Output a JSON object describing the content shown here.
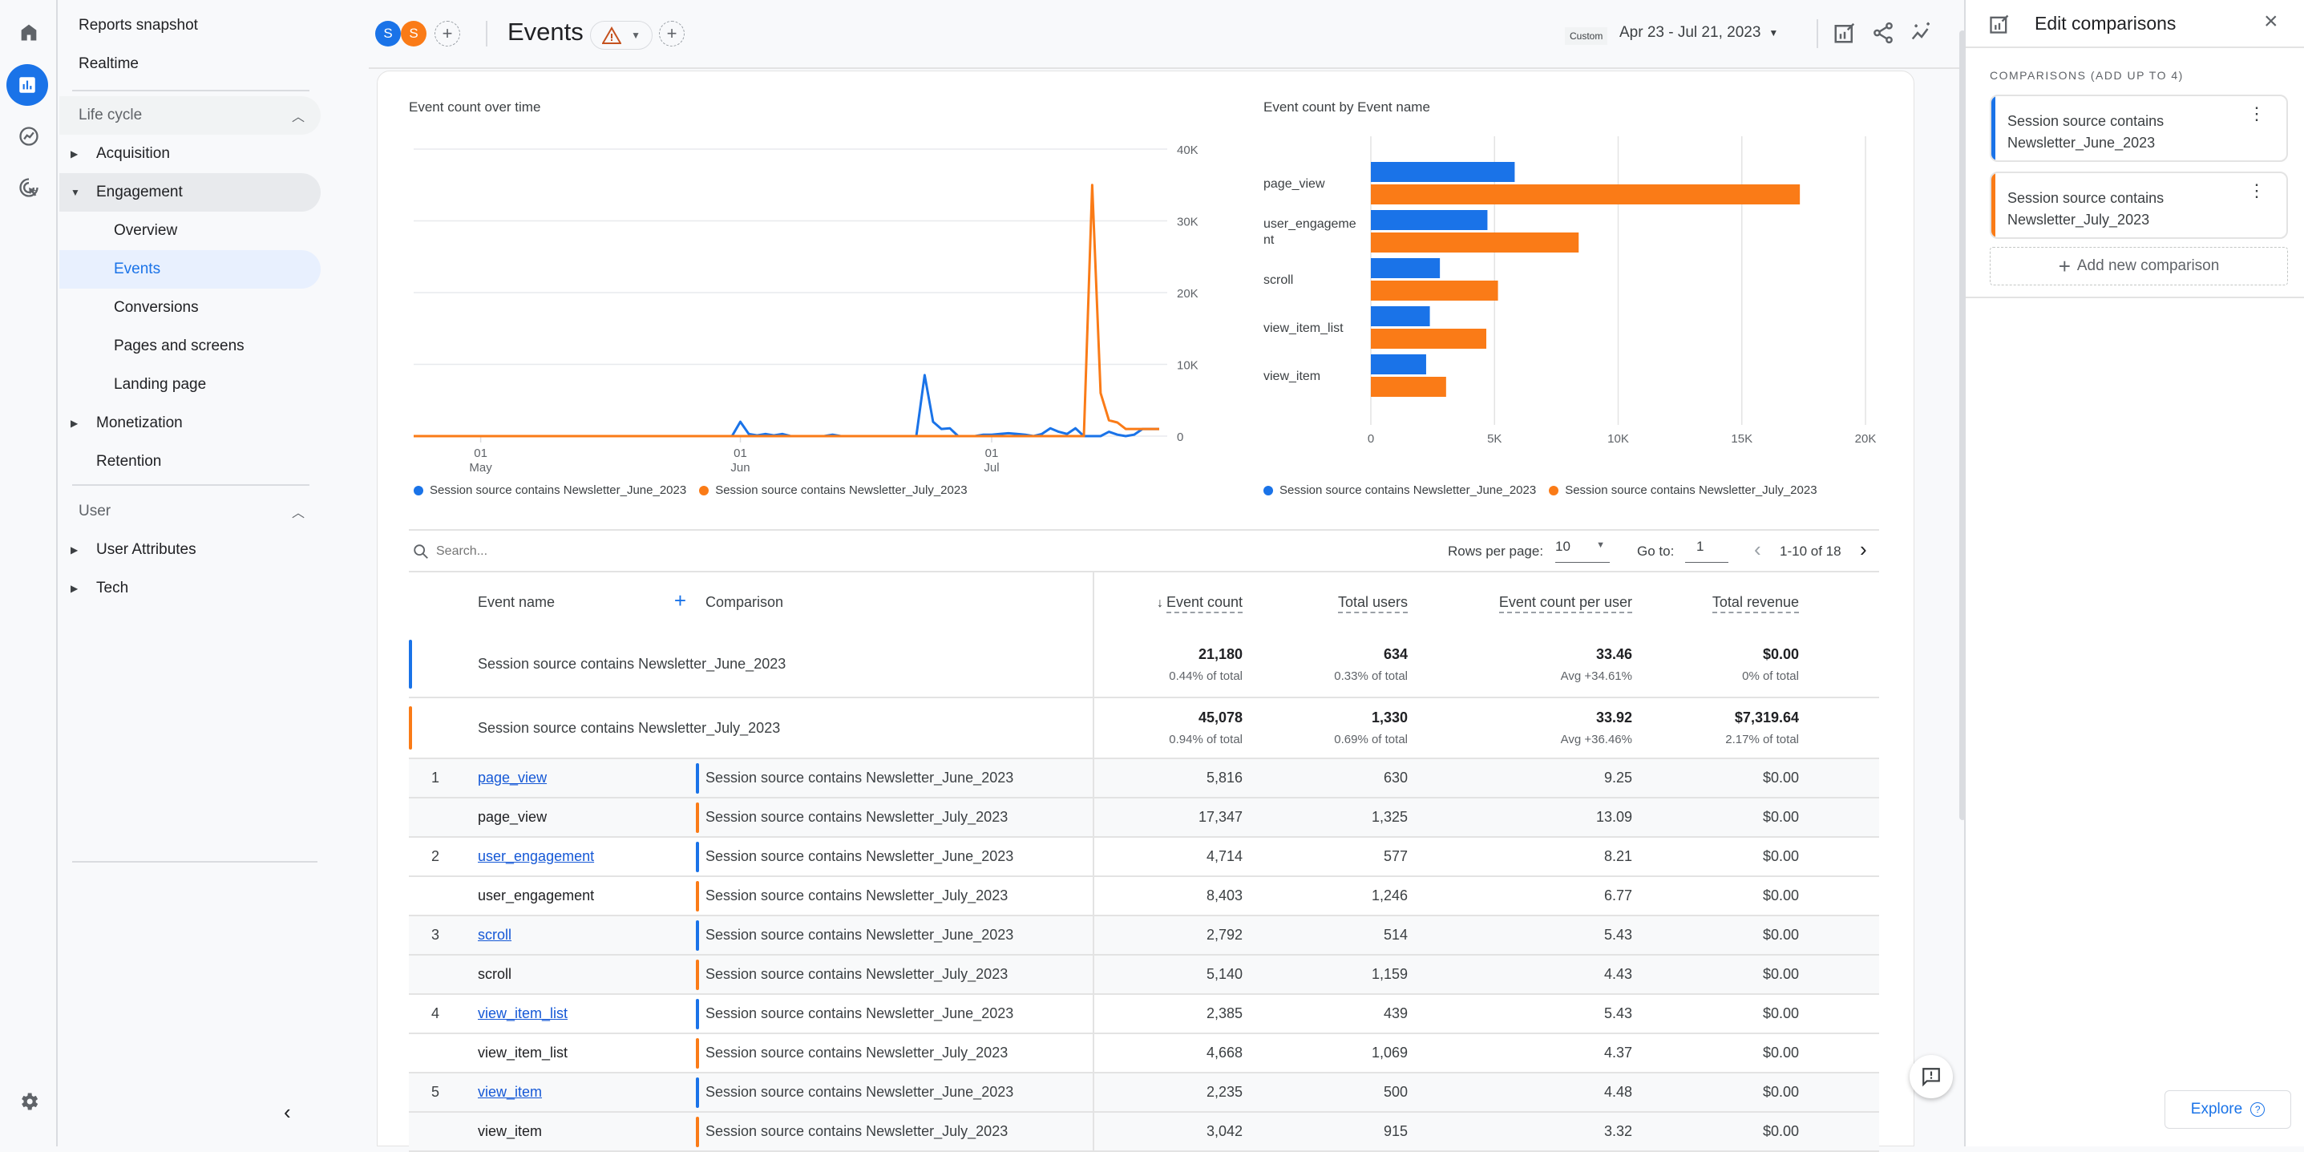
{
  "colors": {
    "blue": "#1a73e8",
    "orange": "#fa7b17",
    "accent": "#1a73e8",
    "warning": "#c5521f"
  },
  "rail": {
    "icons": [
      "home-icon",
      "reports-icon",
      "explore-icon",
      "advertising-icon",
      "settings-icon"
    ]
  },
  "sidebar": {
    "reports_snapshot": "Reports snapshot",
    "realtime": "Realtime",
    "lifecycle": "Life cycle",
    "acquisition": "Acquisition",
    "engagement": "Engagement",
    "overview": "Overview",
    "events": "Events",
    "conversions": "Conversions",
    "pages_and_screens": "Pages and screens",
    "landing_page": "Landing page",
    "monetization": "Monetization",
    "retention": "Retention",
    "user": "User",
    "user_attributes": "User Attributes",
    "tech": "Tech"
  },
  "header": {
    "avatars": [
      "S",
      "S"
    ],
    "title": "Events",
    "date_badge": "Custom",
    "date_range": "Apr 23 - Jul 21, 2023"
  },
  "line_chart": {
    "title": "Event count over time",
    "y_ticks": [
      "40K",
      "30K",
      "20K",
      "10K",
      "0"
    ],
    "x_ticks": [
      {
        "day": "01",
        "month": "May"
      },
      {
        "day": "01",
        "month": "Jun"
      },
      {
        "day": "01",
        "month": "Jul"
      }
    ],
    "legend": [
      "Session source contains Newsletter_June_2023",
      "Session source contains Newsletter_July_2023"
    ]
  },
  "chart_data": [
    {
      "type": "line",
      "title": "Event count over time",
      "xlabel": "",
      "ylabel": "",
      "x_range": [
        "2023-04-23",
        "2023-07-21"
      ],
      "ylim": [
        0,
        40000
      ],
      "y_ticks": [
        0,
        10000,
        20000,
        30000,
        40000
      ],
      "grid": true,
      "legend": "bottom",
      "series": [
        {
          "name": "Session source contains Newsletter_June_2023",
          "color": "#1a73e8",
          "x_days": [
            0,
            38,
            39,
            40,
            41,
            42,
            43,
            44,
            45,
            50,
            51,
            52,
            60,
            61,
            62,
            63,
            64,
            65,
            66,
            67,
            68,
            69,
            70,
            71,
            72,
            73,
            74,
            75,
            76,
            77,
            78,
            79,
            80,
            81,
            82,
            83,
            84,
            85,
            86,
            87,
            88,
            89
          ],
          "values": [
            0,
            0,
            2000,
            300,
            100,
            300,
            100,
            300,
            0,
            200,
            0,
            0,
            0,
            8500,
            2000,
            1000,
            1100,
            0,
            0,
            0,
            200,
            200,
            300,
            400,
            300,
            200,
            0,
            300,
            1100,
            600,
            300,
            1100,
            0,
            0,
            0,
            600,
            200,
            0,
            200,
            1000,
            1000,
            1000
          ]
        },
        {
          "name": "Session source contains Newsletter_July_2023",
          "color": "#fa7b17",
          "x_days": [
            0,
            80,
            81,
            82,
            83,
            84,
            85,
            86,
            87,
            88
          ],
          "values": [
            0,
            0,
            35000,
            6000,
            2200,
            1900,
            1000,
            1000,
            1000,
            1000
          ]
        }
      ]
    },
    {
      "type": "bar",
      "orientation": "horizontal",
      "title": "Event count by Event name",
      "categories": [
        "page_view",
        "user_engagement",
        "scroll",
        "view_item_list",
        "view_item"
      ],
      "series": [
        {
          "name": "Session source contains Newsletter_June_2023",
          "color": "#1a73e8",
          "values": [
            5816,
            4714,
            2792,
            2385,
            2235
          ]
        },
        {
          "name": "Session source contains Newsletter_July_2023",
          "color": "#fa7b17",
          "values": [
            17347,
            8403,
            5140,
            4668,
            3042
          ]
        }
      ],
      "xlim": [
        0,
        20000
      ],
      "x_ticks": [
        "0",
        "5K",
        "10K",
        "15K",
        "20K"
      ],
      "grid": true,
      "legend": "bottom"
    }
  ],
  "bar_chart": {
    "title": "Event count by Event name",
    "category_labels": [
      "page_view",
      "user_engageme\nnt",
      "scroll",
      "view_item_list",
      "view_item"
    ],
    "x_ticks": [
      "0",
      "5K",
      "10K",
      "15K",
      "20K"
    ],
    "legend": [
      "Session source contains Newsletter_June_2023",
      "Session source contains Newsletter_July_2023"
    ]
  },
  "table_toolbar": {
    "search_placeholder": "Search...",
    "rows_per_page_label": "Rows per page:",
    "rows_per_page": "10",
    "goto_label": "Go to:",
    "goto_value": "1",
    "range": "1-10 of 18"
  },
  "table": {
    "headers": {
      "event_name": "Event name",
      "comparison": "Comparison",
      "event_count": "Event count",
      "total_users": "Total users",
      "per_user": "Event count per user",
      "revenue": "Total revenue"
    },
    "totals": [
      {
        "label": "Session source contains Newsletter_June_2023",
        "color": "#1a73e8",
        "event_count": "21,180",
        "event_count_sub": "0.44% of total",
        "total_users": "634",
        "total_users_sub": "0.33% of total",
        "per_user": "33.46",
        "per_user_sub": "Avg +34.61%",
        "revenue": "$0.00",
        "revenue_sub": "0% of total"
      },
      {
        "label": "Session source contains Newsletter_July_2023",
        "color": "#fa7b17",
        "event_count": "45,078",
        "event_count_sub": "0.94% of total",
        "total_users": "1,330",
        "total_users_sub": "0.69% of total",
        "per_user": "33.92",
        "per_user_sub": "Avg +36.46%",
        "revenue": "$7,319.64",
        "revenue_sub": "2.17% of total"
      }
    ],
    "rows": [
      {
        "rank": "1",
        "event": "page_view",
        "comparison": "Session source contains Newsletter_June_2023",
        "series": "june",
        "event_count": "5,816",
        "total_users": "630",
        "per_user": "9.25",
        "revenue": "$0.00"
      },
      {
        "rank": "",
        "event": "page_view",
        "comparison": "Session source contains Newsletter_July_2023",
        "series": "july",
        "event_count": "17,347",
        "total_users": "1,325",
        "per_user": "13.09",
        "revenue": "$0.00"
      },
      {
        "rank": "2",
        "event": "user_engagement",
        "comparison": "Session source contains Newsletter_June_2023",
        "series": "june",
        "event_count": "4,714",
        "total_users": "577",
        "per_user": "8.21",
        "revenue": "$0.00"
      },
      {
        "rank": "",
        "event": "user_engagement",
        "comparison": "Session source contains Newsletter_July_2023",
        "series": "july",
        "event_count": "8,403",
        "total_users": "1,246",
        "per_user": "6.77",
        "revenue": "$0.00"
      },
      {
        "rank": "3",
        "event": "scroll",
        "comparison": "Session source contains Newsletter_June_2023",
        "series": "june",
        "event_count": "2,792",
        "total_users": "514",
        "per_user": "5.43",
        "revenue": "$0.00"
      },
      {
        "rank": "",
        "event": "scroll",
        "comparison": "Session source contains Newsletter_July_2023",
        "series": "july",
        "event_count": "5,140",
        "total_users": "1,159",
        "per_user": "4.43",
        "revenue": "$0.00"
      },
      {
        "rank": "4",
        "event": "view_item_list",
        "comparison": "Session source contains Newsletter_June_2023",
        "series": "june",
        "event_count": "2,385",
        "total_users": "439",
        "per_user": "5.43",
        "revenue": "$0.00"
      },
      {
        "rank": "",
        "event": "view_item_list",
        "comparison": "Session source contains Newsletter_July_2023",
        "series": "july",
        "event_count": "4,668",
        "total_users": "1,069",
        "per_user": "4.37",
        "revenue": "$0.00"
      },
      {
        "rank": "5",
        "event": "view_item",
        "comparison": "Session source contains Newsletter_June_2023",
        "series": "june",
        "event_count": "2,235",
        "total_users": "500",
        "per_user": "4.48",
        "revenue": "$0.00"
      },
      {
        "rank": "",
        "event": "view_item",
        "comparison": "Session source contains Newsletter_July_2023",
        "series": "july",
        "event_count": "3,042",
        "total_users": "915",
        "per_user": "3.32",
        "revenue": "$0.00"
      }
    ]
  },
  "panel": {
    "title": "Edit comparisons",
    "section_label": "COMPARISONS (ADD UP TO 4)",
    "comparisons": [
      {
        "line1": "Session source contains",
        "line2": "Newsletter_June_2023",
        "color": "#1a73e8"
      },
      {
        "line1": "Session source contains",
        "line2": "Newsletter_July_2023",
        "color": "#fa7b17"
      }
    ],
    "add_label": "Add new comparison",
    "explore_label": "Explore"
  }
}
